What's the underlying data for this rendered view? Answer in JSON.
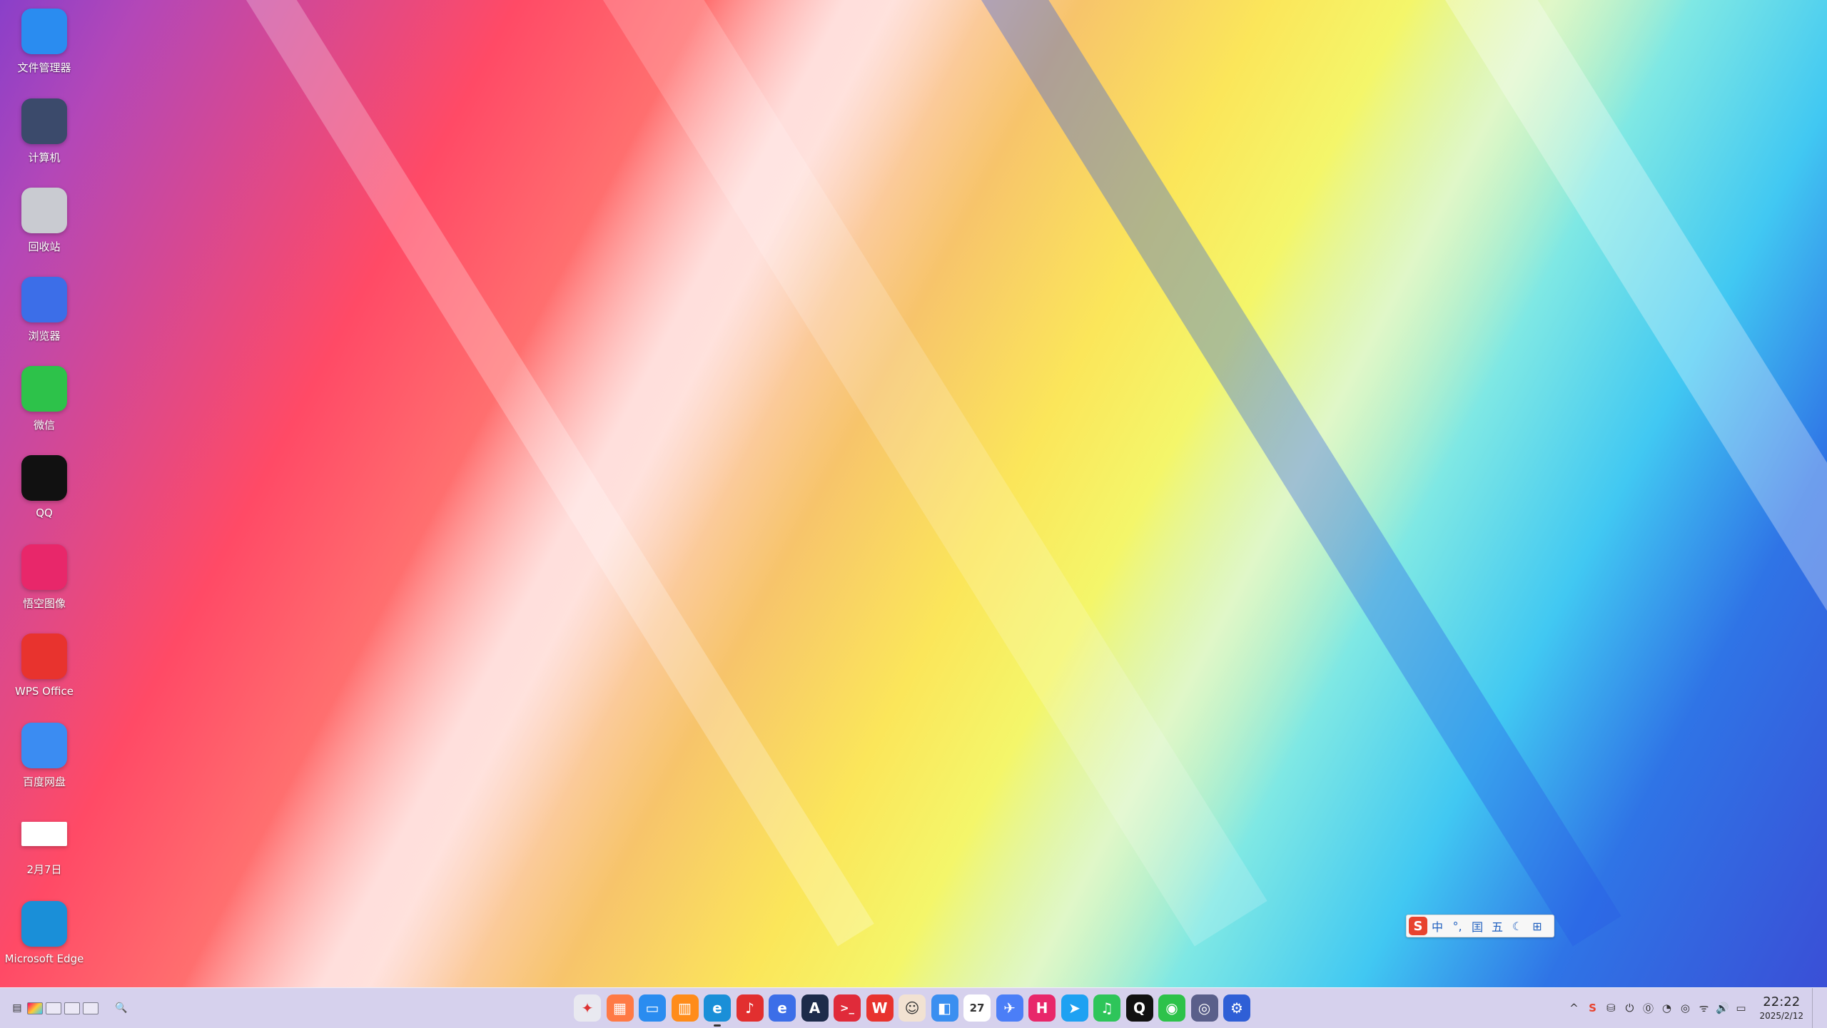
{
  "desktop": {
    "icons": [
      {
        "label": "文件管理器",
        "icon": "file-manager-icon",
        "color": "#2a8cf0"
      },
      {
        "label": "计算机",
        "icon": "computer-icon",
        "color": "#3b4a6b"
      },
      {
        "label": "回收站",
        "icon": "recycle-bin-icon",
        "color": "#c9cbd1"
      },
      {
        "label": "浏览器",
        "icon": "browser-icon",
        "color": "#3c6ee8"
      },
      {
        "label": "微信",
        "icon": "wechat-icon",
        "color": "#2dc24a"
      },
      {
        "label": "QQ",
        "icon": "qq-penguin-icon",
        "color": "#111111"
      },
      {
        "label": "悟空图像",
        "icon": "wukong-image-icon",
        "color": "#e8276a"
      },
      {
        "label": "WPS Office",
        "icon": "wps-office-icon",
        "color": "#e8332e"
      },
      {
        "label": "百度网盘",
        "icon": "baidu-netdisk-icon",
        "color": "#3b8cf2"
      },
      {
        "label": "2月7日",
        "icon": "image-file-icon",
        "color": "#ffffff"
      },
      {
        "label": "Microsoft Edge",
        "icon": "edge-icon",
        "color": "#1a8fd8"
      }
    ]
  },
  "ime": {
    "logo": "S",
    "buttons": [
      "中",
      "°,",
      "囯",
      "五",
      "☾",
      "⊞"
    ]
  },
  "taskbar": {
    "search_glyph": "🔍",
    "apps": [
      {
        "name": "launcher",
        "glyph": "✦",
        "color": "#e9e9f0",
        "fg": "#d33"
      },
      {
        "name": "app-store",
        "glyph": "▦",
        "color": "#ff7a45",
        "fg": "#fff"
      },
      {
        "name": "file-manager",
        "glyph": "▭",
        "color": "#2a8cf0",
        "fg": "#fff"
      },
      {
        "name": "archive",
        "glyph": "▥",
        "color": "#ff8c1a",
        "fg": "#fff"
      },
      {
        "name": "edge",
        "glyph": "e",
        "color": "#1a8fd8",
        "fg": "#fff"
      },
      {
        "name": "music-netease",
        "glyph": "♪",
        "color": "#e22f2f",
        "fg": "#fff"
      },
      {
        "name": "browser",
        "glyph": "e",
        "color": "#3c6ee8",
        "fg": "#fff"
      },
      {
        "name": "text-editor",
        "glyph": "A",
        "color": "#1d2b4a",
        "fg": "#fff"
      },
      {
        "name": "terminal",
        "glyph": ">_",
        "color": "#e02b3a",
        "fg": "#fff"
      },
      {
        "name": "wps",
        "glyph": "W",
        "color": "#e8332e",
        "fg": "#fff"
      },
      {
        "name": "avatar-app",
        "glyph": "☺",
        "color": "#f2e2d2",
        "fg": "#333"
      },
      {
        "name": "control-panel",
        "glyph": "◧",
        "color": "#3a8ff0",
        "fg": "#fff"
      },
      {
        "name": "calendar",
        "glyph": "27",
        "color": "#ffffff",
        "fg": "#333"
      },
      {
        "name": "feishu",
        "glyph": "✈",
        "color": "#4b7ef7",
        "fg": "#fff"
      },
      {
        "name": "wukong-image",
        "glyph": "H",
        "color": "#e8276a",
        "fg": "#fff"
      },
      {
        "name": "feige",
        "glyph": "➤",
        "color": "#1ea1f2",
        "fg": "#fff"
      },
      {
        "name": "music",
        "glyph": "♫",
        "color": "#2ec55a",
        "fg": "#fff"
      },
      {
        "name": "qq",
        "glyph": "Q",
        "color": "#111111",
        "fg": "#fff"
      },
      {
        "name": "wechat",
        "glyph": "◉",
        "color": "#2dc24a",
        "fg": "#fff"
      },
      {
        "name": "camera",
        "glyph": "◎",
        "color": "#5a5f8a",
        "fg": "#fff"
      },
      {
        "name": "settings",
        "glyph": "⚙",
        "color": "#2f5fd6",
        "fg": "#fff"
      }
    ],
    "tray": [
      "^",
      "S",
      "⛁",
      "⏻",
      "⓪",
      "◔",
      "◎",
      "ᯤ",
      "🔊",
      "▭"
    ],
    "clock": {
      "time": "22:22",
      "date": "2025/2/12"
    }
  }
}
